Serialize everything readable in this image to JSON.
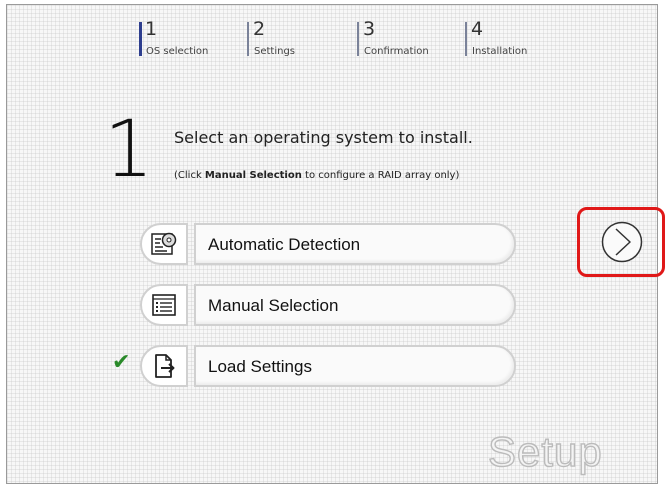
{
  "steps": [
    {
      "num": "1",
      "label": "OS selection"
    },
    {
      "num": "2",
      "label": "Settings"
    },
    {
      "num": "3",
      "label": "Confirmation"
    },
    {
      "num": "4",
      "label": "Installation"
    }
  ],
  "current_step_number": "1",
  "title": "Select an operating system to install.",
  "subtitle": {
    "before": "(Click ",
    "bold": "Manual Selection",
    "after": " to configure a RAID array only)"
  },
  "options": [
    {
      "label": "Automatic Detection",
      "icon": "disc-icon"
    },
    {
      "label": "Manual Selection",
      "icon": "list-icon"
    },
    {
      "label": "Load Settings",
      "icon": "file-import-icon",
      "checked": true
    }
  ],
  "check_mark": "✔",
  "watermark": "Setup",
  "colors": {
    "accent": "#2e3e8e",
    "highlight": "#e01818",
    "check": "#2a8a2a"
  }
}
